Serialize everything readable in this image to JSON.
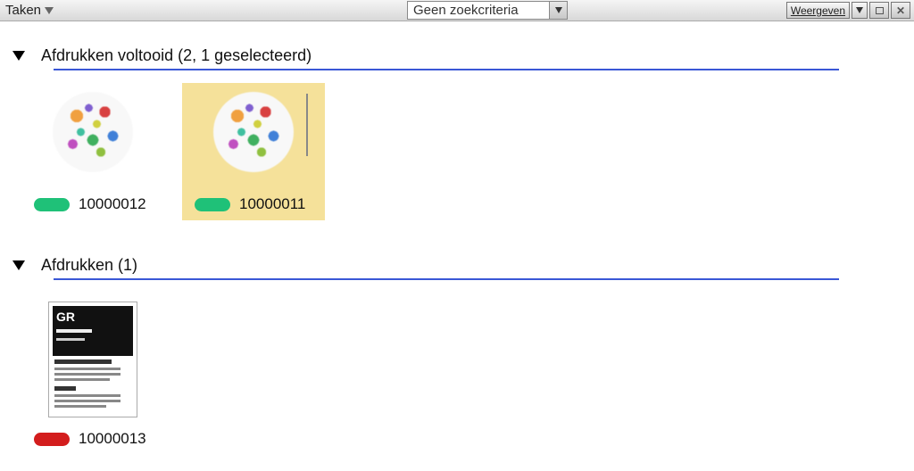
{
  "toolbar": {
    "title": "Taken",
    "search_label": "Geen zoekcriteria",
    "view_button": "Weergeven"
  },
  "sections": {
    "completed": {
      "title": "Afdrukken voltooid (2, 1 geselecteerd)",
      "items": [
        {
          "id": "10000012",
          "status": "green",
          "selected": false
        },
        {
          "id": "10000011",
          "status": "green",
          "selected": true
        }
      ]
    },
    "printing": {
      "title": "Afdrukken (1)",
      "items": [
        {
          "id": "10000013",
          "status": "red",
          "selected": false,
          "doc_label": "GR"
        }
      ]
    }
  }
}
